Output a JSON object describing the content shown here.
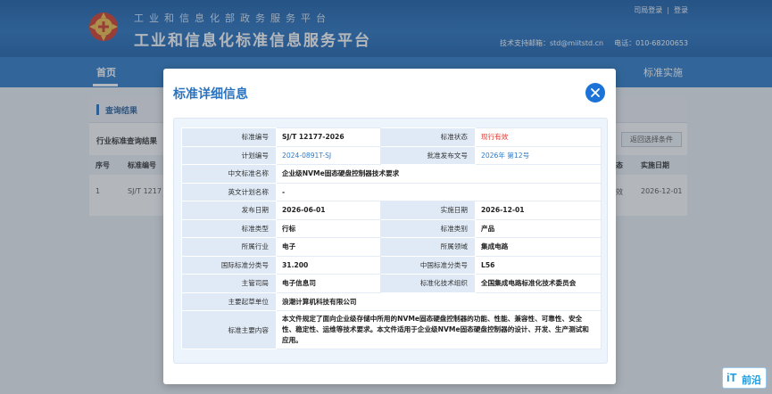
{
  "header": {
    "subtitle": "工业和信息化部政务服务平台",
    "title": "工业和信息化标准信息服务平台",
    "links": {
      "login": "司局登录",
      "separator": "|",
      "logout": "登录"
    },
    "contact": {
      "email": "技术支持邮箱：std@miitstd.cn",
      "phone": "电话：010-68200653"
    }
  },
  "nav": {
    "home": "首页",
    "right_item": "标准实施"
  },
  "background": {
    "section_label": "查询结果",
    "sub_title": "行业标准查询结果",
    "back_button": "返回选择条件",
    "columns": [
      "序号",
      "标准编号",
      "态",
      "实施日期"
    ],
    "row": [
      "1",
      "SJ/T 1217",
      "效",
      "2026-12-01"
    ]
  },
  "modal": {
    "title": "标准详细信息",
    "rows": [
      {
        "l1": "标准编号",
        "v1": "SJ/T 12177-2026",
        "l2": "标准状态",
        "v2": "现行有效"
      },
      {
        "l1": "计划编号",
        "v1": "2024-0891T-SJ",
        "l2": "批准发布文号",
        "v2": "2026年 第12号"
      },
      {
        "l1": "中文标准名称",
        "v1": "企业级NVMe固态硬盘控制器技术要求"
      },
      {
        "l1": "英文计划名称",
        "v1": "-"
      },
      {
        "l1": "发布日期",
        "v1": "2026-06-01",
        "l2": "实施日期",
        "v2": "2026-12-01"
      },
      {
        "l1": "标准类型",
        "v1": "行标",
        "l2": "标准类别",
        "v2": "产品"
      },
      {
        "l1": "所属行业",
        "v1": "电子",
        "l2": "所属领域",
        "v2": "集成电路"
      },
      {
        "l1": "国际标准分类号",
        "v1": "31.200",
        "l2": "中国标准分类号",
        "v2": "L56"
      },
      {
        "l1": "主管司局",
        "v1": "电子信息司",
        "l2": "标准化技术组织",
        "v2": "全国集成电路标准化技术委员会"
      },
      {
        "l1": "主要起草单位",
        "v1": "浪潮计算机科技有限公司"
      },
      {
        "l1": "标准主要内容",
        "v1": "本文件规定了面向企业级存储中所用的NVMe固态硬盘控制器的功能、性能、兼容性、可靠性、安全性、稳定性、运维等技术要求。本文件适用于企业级NVMe固态硬盘控制器的设计、开发、生产测试和应用。"
      }
    ]
  },
  "watermark": {
    "it": "iT",
    "cn": "前沿"
  },
  "colors": {
    "accent": "#2a73bf",
    "status_red": "#e0332b",
    "link_blue": "#2f7cc9",
    "close_blue": "#1b73d8"
  },
  "icons": {
    "logo": "ministry-logo-icon",
    "close": "close-icon"
  }
}
